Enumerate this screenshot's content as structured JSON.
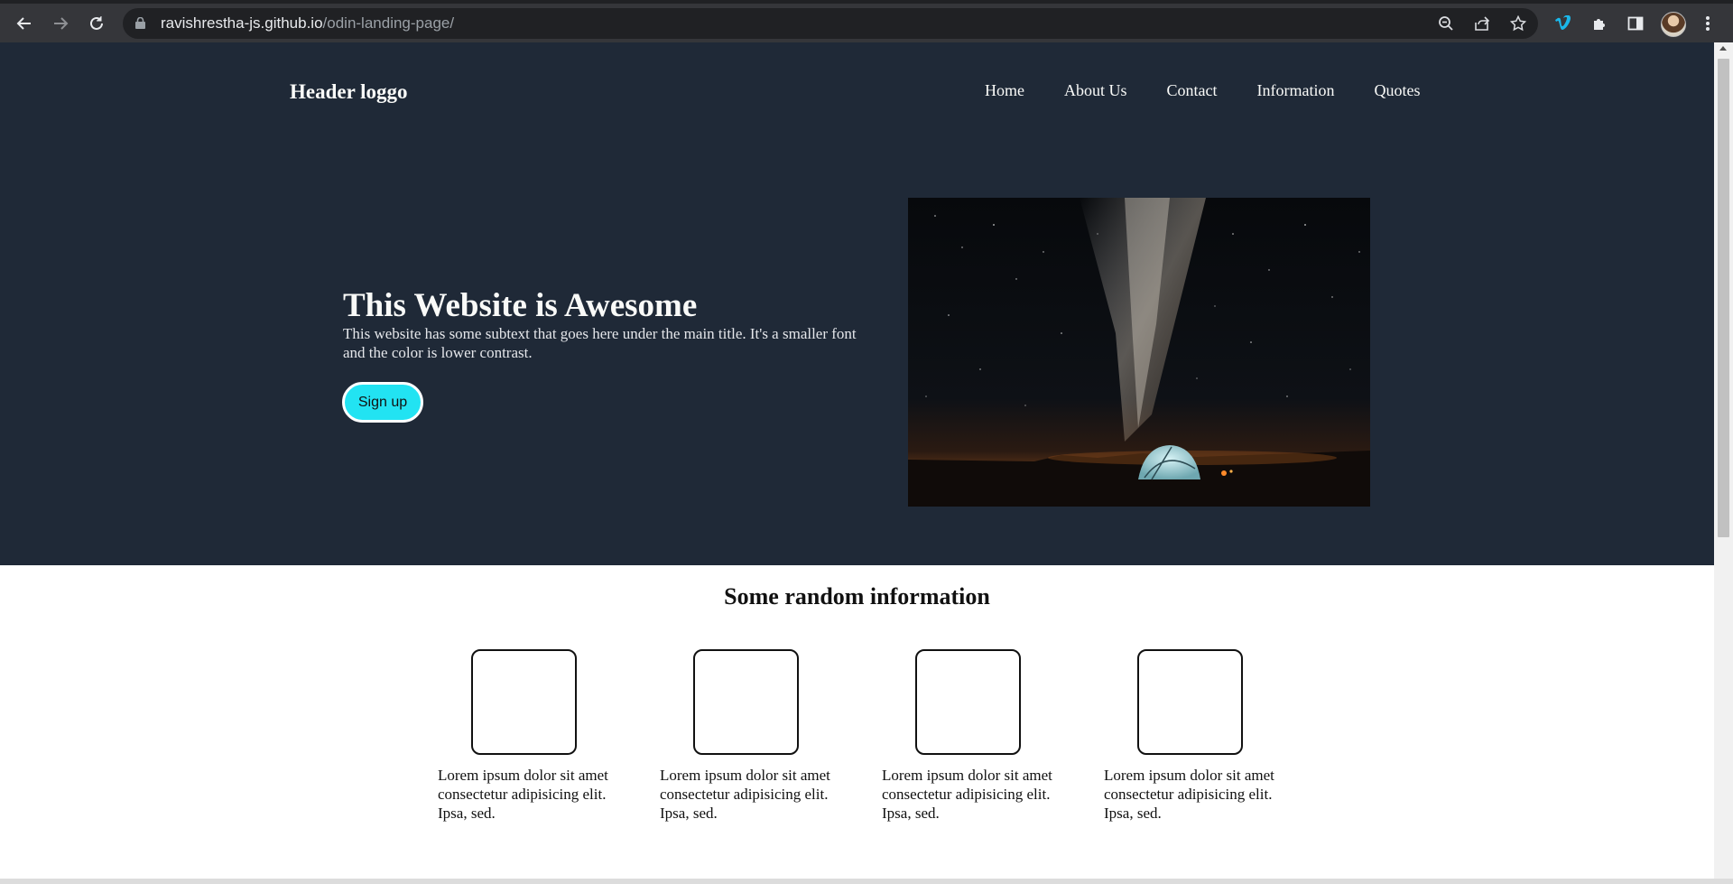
{
  "browser": {
    "url_host": "ravishrestha-js.github.io",
    "url_path": "/odin-landing-page/",
    "icons": [
      "back-icon",
      "forward-icon",
      "reload-icon",
      "lock-icon",
      "zoom-icon",
      "share-icon",
      "star-icon",
      "vimeo-icon",
      "extensions-icon",
      "sidepanel-icon",
      "avatar",
      "menu-icon"
    ]
  },
  "header": {
    "logo": "Header loggo",
    "nav": [
      "Home",
      "About Us",
      "Contact",
      "Information",
      "Quotes"
    ]
  },
  "hero": {
    "title": "This Website is Awesome",
    "subtitle": "This website has some subtext that goes here under the main title. It's a smaller font and the color is lower contrast.",
    "button": "Sign up",
    "image": "night-sky-tent-image"
  },
  "info": {
    "title": "Some random information",
    "cards": [
      {
        "text": "Lorem ipsum dolor sit amet consectetur adipisicing elit. Ipsa, sed."
      },
      {
        "text": "Lorem ipsum dolor sit amet consectetur adipisicing elit. Ipsa, sed."
      },
      {
        "text": "Lorem ipsum dolor sit amet consectetur adipisicing elit. Ipsa, sed."
      },
      {
        "text": "Lorem ipsum dolor sit amet consectetur adipisicing elit. Ipsa, sed."
      }
    ]
  },
  "colors": {
    "hero_bg": "#1f2937",
    "button_bg": "#22e3f2",
    "chrome_bg": "#35363a"
  }
}
